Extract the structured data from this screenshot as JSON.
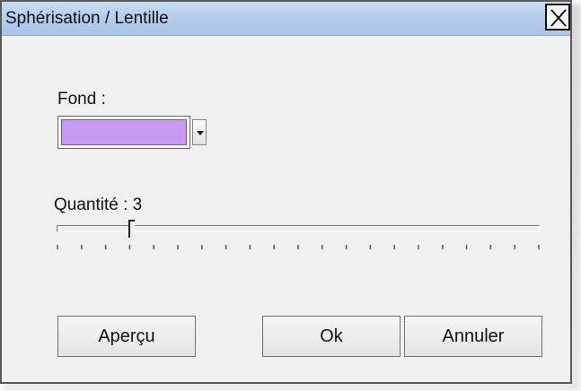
{
  "window": {
    "title": "Sphérisation / Lentille",
    "close_glyph": "✕"
  },
  "background": {
    "label": "Fond :",
    "selected_color": "#c79af2"
  },
  "amount": {
    "label": "Quantité : 3",
    "value": 3,
    "min": 0,
    "max": 20
  },
  "buttons": {
    "preview": "Aperçu",
    "ok": "Ok",
    "cancel": "Annuler"
  }
}
